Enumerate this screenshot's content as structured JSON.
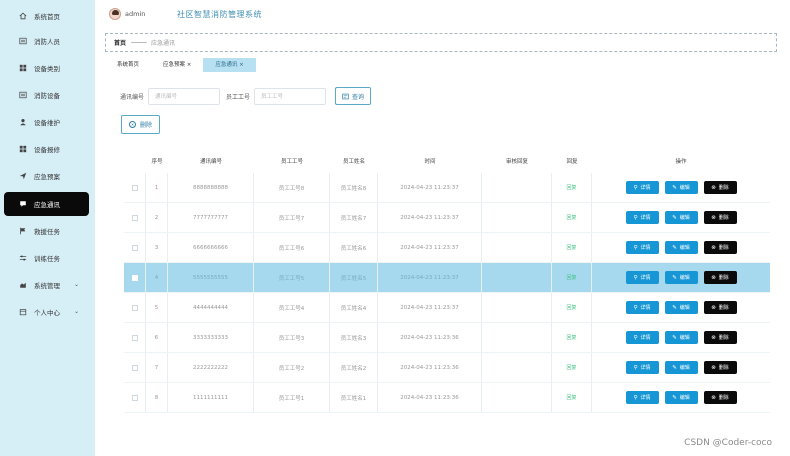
{
  "header": {
    "username": "admin",
    "app_title": "社区智慧消防管理系统"
  },
  "sidebar": {
    "items": [
      {
        "label": "系统首页",
        "icon": "home-icon"
      },
      {
        "label": "消防人员",
        "icon": "list-icon"
      },
      {
        "label": "设备类别",
        "icon": "grid-icon"
      },
      {
        "label": "消防设备",
        "icon": "list-icon"
      },
      {
        "label": "设备维护",
        "icon": "user-icon"
      },
      {
        "label": "设备报修",
        "icon": "grid-icon"
      },
      {
        "label": "应急预案",
        "icon": "send-icon"
      },
      {
        "label": "应急通讯",
        "icon": "chat-icon"
      },
      {
        "label": "救援任务",
        "icon": "flag-icon"
      },
      {
        "label": "训练任务",
        "icon": "sliders-icon"
      },
      {
        "label": "系统管理",
        "icon": "cog-icon"
      },
      {
        "label": "个人中心",
        "icon": "calendar-icon"
      }
    ],
    "active_index": 7
  },
  "breadcrumb": {
    "home": "首页",
    "sep": "———",
    "current": "应急通讯"
  },
  "tabs": [
    {
      "label": "系统首页"
    },
    {
      "label": "应急预案 ×"
    },
    {
      "label": "应急通讯 ×"
    }
  ],
  "search": {
    "code_label": "通讯编号",
    "code_placeholder": "通讯编号",
    "eno_label": "员工工号",
    "eno_placeholder": "员工工号",
    "query_label": "查询"
  },
  "actions": {
    "delete_label": "删除"
  },
  "table": {
    "headers": [
      "序号",
      "通讯编号",
      "员工工号",
      "员工姓名",
      "时间",
      "审核回复",
      "回复",
      "操作"
    ],
    "rows": [
      {
        "no": "1",
        "code": "8888888888",
        "eno": "员工工号8",
        "ename": "员工姓名8",
        "time": "2024-04-23 11:23:37",
        "reply": "回复"
      },
      {
        "no": "2",
        "code": "7777777777",
        "eno": "员工工号7",
        "ename": "员工姓名7",
        "time": "2024-04-23 11:23:37",
        "reply": "回复"
      },
      {
        "no": "3",
        "code": "6666666666",
        "eno": "员工工号6",
        "ename": "员工姓名6",
        "time": "2024-04-23 11:23:37",
        "reply": "回复"
      },
      {
        "no": "4",
        "code": "5555555555",
        "eno": "员工工号5",
        "ename": "员工姓名5",
        "time": "2024-04-23 11:23:37",
        "reply": "回复"
      },
      {
        "no": "5",
        "code": "4444444444",
        "eno": "员工工号4",
        "ename": "员工姓名4",
        "time": "2024-04-23 11:23:37",
        "reply": "回复"
      },
      {
        "no": "6",
        "code": "3333333333",
        "eno": "员工工号3",
        "ename": "员工姓名3",
        "time": "2024-04-23 11:23:36",
        "reply": "回复"
      },
      {
        "no": "7",
        "code": "2222222222",
        "eno": "员工工号2",
        "ename": "员工姓名2",
        "time": "2024-04-23 11:23:36",
        "reply": "回复"
      },
      {
        "no": "8",
        "code": "1111111111",
        "eno": "员工工号1",
        "ename": "员工姓名1",
        "time": "2024-04-23 11:23:36",
        "reply": "回复"
      }
    ],
    "selected_index": 3,
    "ops": {
      "detail": "详情",
      "edit": "编辑",
      "remove": "删除"
    }
  },
  "watermark": "CSDN @Coder-coco",
  "colors": {
    "sidebar_bg": "#d6eef6",
    "accent": "#1796d6",
    "selected_row": "#a6d9ee",
    "active_nav": "#0a0a0a"
  }
}
